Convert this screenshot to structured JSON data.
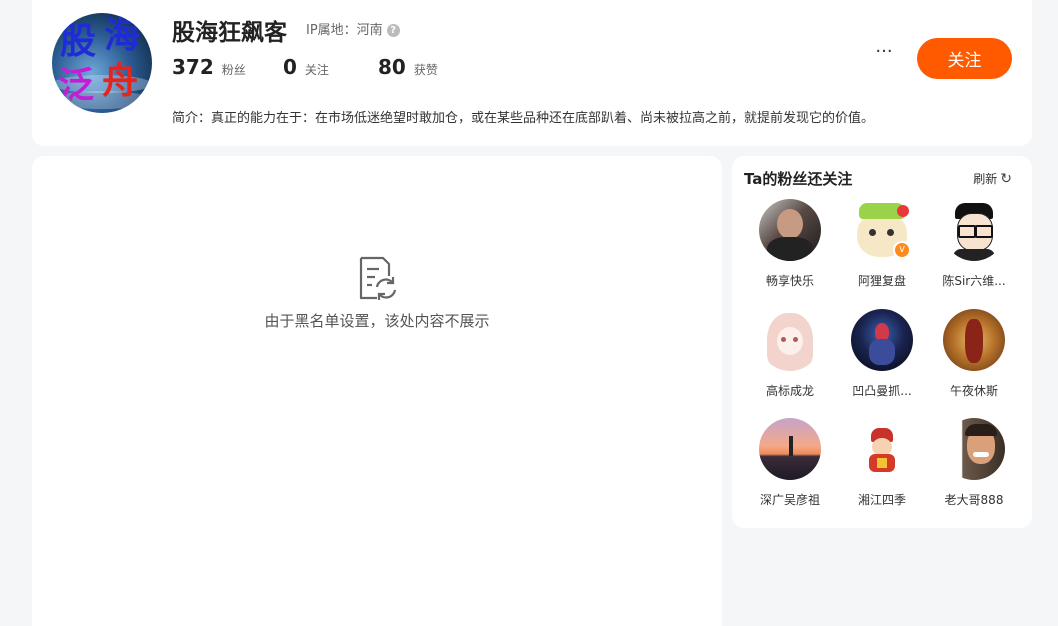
{
  "profile": {
    "name": "股海狂飙客",
    "ip_label": "IP属地：河南",
    "ip_help_glyph": "?",
    "avatar_text": [
      "股",
      "海",
      "泛",
      "舟"
    ],
    "stats": [
      {
        "num": "372",
        "label": "粉丝"
      },
      {
        "num": "0",
        "label": "关注"
      },
      {
        "num": "80",
        "label": "获赞"
      }
    ],
    "bio": "简介：真正的能力在于：在市场低迷绝望时敢加仓，或在某些品种还在底部趴着、尚未被拉高之前，就提前发现它的价值。",
    "more_label": "···",
    "follow_label": "关注",
    "accent_color": "#ff5a00"
  },
  "content": {
    "empty_text": "由于黑名单设置，该处内容不展示",
    "empty_icon": "document-refresh-icon"
  },
  "sidebar": {
    "title": "Ta的粉丝还关注",
    "refresh_label": "刷新",
    "refresh_icon": "refresh-icon",
    "users": [
      {
        "name": "畅享快乐"
      },
      {
        "name": "阿狸复盘"
      },
      {
        "name": "陈Sir六维..."
      },
      {
        "name": "高标成龙"
      },
      {
        "name": "凹凸曼抓..."
      },
      {
        "name": "午夜休斯"
      },
      {
        "name": "深广吴彦祖"
      },
      {
        "name": "湘江四季"
      },
      {
        "name": "老大哥888"
      }
    ]
  }
}
